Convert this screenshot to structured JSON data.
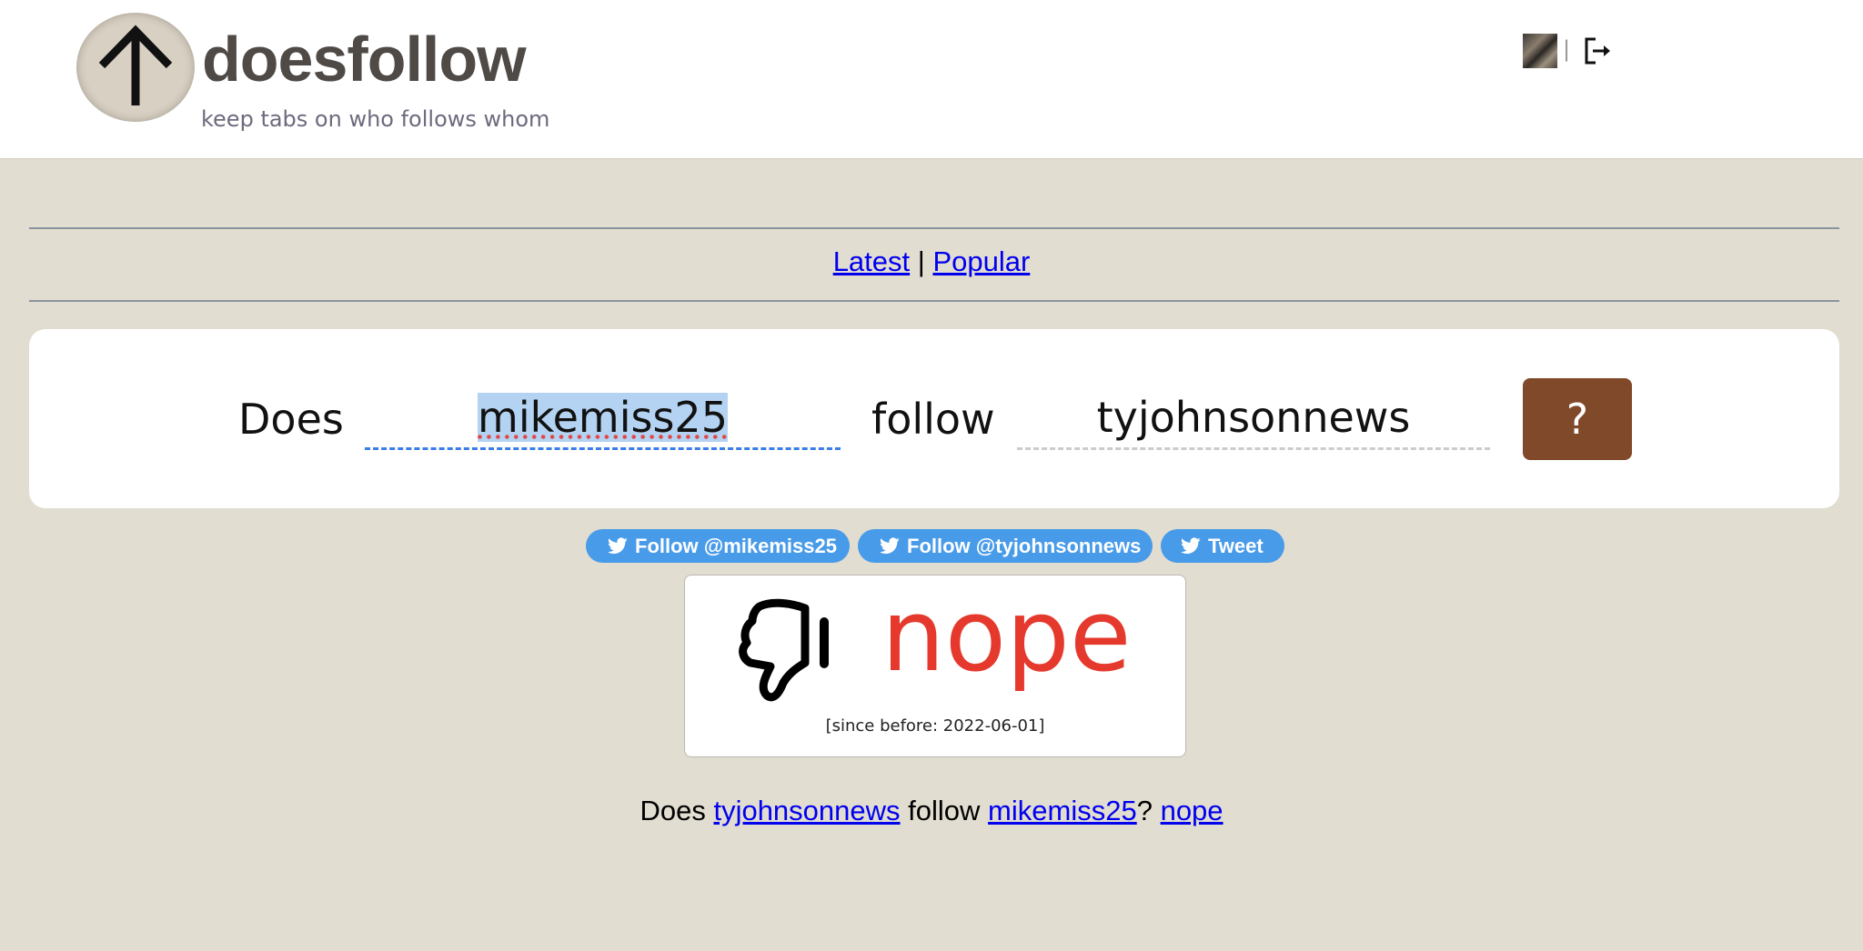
{
  "header": {
    "brand": "doesfollow",
    "tagline": "keep tabs on who follows whom",
    "separator": "|"
  },
  "nav": {
    "latest": "Latest",
    "separator": "|",
    "popular": "Popular"
  },
  "query": {
    "does_label": "Does",
    "user_a": "mikemiss25",
    "follow_label": "follow",
    "user_b": "tyjohnsonnews",
    "submit_label": "?"
  },
  "twitter_buttons": {
    "follow_a": "Follow @mikemiss25",
    "follow_b": "Follow @tyjohnsonnews",
    "tweet": "Tweet"
  },
  "result": {
    "answer": "nope",
    "since": "[since before: 2022-06-01]",
    "answer_color": "#e5392d"
  },
  "reverse": {
    "does": "Does",
    "user_b": "tyjohnsonnews",
    "follow": "follow",
    "user_a": "mikemiss25",
    "qmark": "?",
    "answer": "nope"
  },
  "colors": {
    "background": "#e2ddd1",
    "submit_button": "#80492a",
    "twitter_blue": "#489be9",
    "link": "#0000ee"
  },
  "icons": [
    "up-arrow-logo-icon",
    "avatar-image",
    "logout-icon",
    "twitter-bird-icon",
    "thumbs-down-icon"
  ]
}
